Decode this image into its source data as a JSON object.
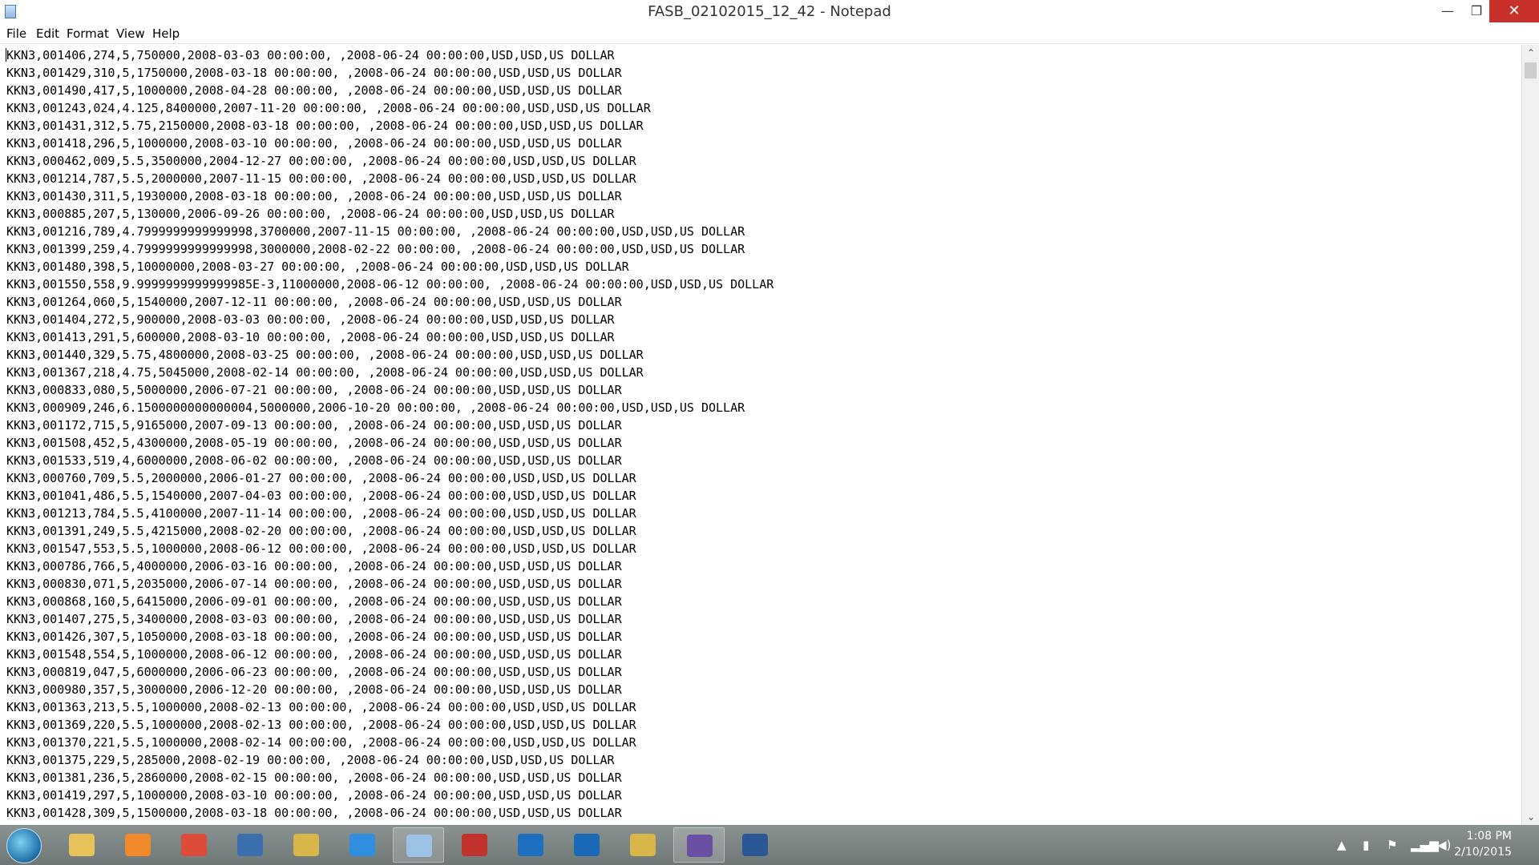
{
  "window": {
    "title": "FASB_02102015_12_42 - Notepad",
    "minimize_glyph": "—",
    "maximize_glyph": "❐",
    "close_glyph": "✕"
  },
  "menu": [
    "File",
    "Edit",
    "Format",
    "View",
    "Help"
  ],
  "lines": [
    "KKN3,001406,274,5,750000,2008-03-03 00:00:00, ,2008-06-24 00:00:00,USD,USD,US DOLLAR",
    "KKN3,001429,310,5,1750000,2008-03-18 00:00:00, ,2008-06-24 00:00:00,USD,USD,US DOLLAR",
    "KKN3,001490,417,5,1000000,2008-04-28 00:00:00, ,2008-06-24 00:00:00,USD,USD,US DOLLAR",
    "KKN3,001243,024,4.125,8400000,2007-11-20 00:00:00, ,2008-06-24 00:00:00,USD,USD,US DOLLAR",
    "KKN3,001431,312,5.75,2150000,2008-03-18 00:00:00, ,2008-06-24 00:00:00,USD,USD,US DOLLAR",
    "KKN3,001418,296,5,1000000,2008-03-10 00:00:00, ,2008-06-24 00:00:00,USD,USD,US DOLLAR",
    "KKN3,000462,009,5.5,3500000,2004-12-27 00:00:00, ,2008-06-24 00:00:00,USD,USD,US DOLLAR",
    "KKN3,001214,787,5.5,2000000,2007-11-15 00:00:00, ,2008-06-24 00:00:00,USD,USD,US DOLLAR",
    "KKN3,001430,311,5,1930000,2008-03-18 00:00:00, ,2008-06-24 00:00:00,USD,USD,US DOLLAR",
    "KKN3,000885,207,5,130000,2006-09-26 00:00:00, ,2008-06-24 00:00:00,USD,USD,US DOLLAR",
    "KKN3,001216,789,4.7999999999999998,3700000,2007-11-15 00:00:00, ,2008-06-24 00:00:00,USD,USD,US DOLLAR",
    "KKN3,001399,259,4.7999999999999998,3000000,2008-02-22 00:00:00, ,2008-06-24 00:00:00,USD,USD,US DOLLAR",
    "KKN3,001480,398,5,10000000,2008-03-27 00:00:00, ,2008-06-24 00:00:00,USD,USD,US DOLLAR",
    "KKN3,001550,558,9.9999999999999985E-3,11000000,2008-06-12 00:00:00, ,2008-06-24 00:00:00,USD,USD,US DOLLAR",
    "KKN3,001264,060,5,1540000,2007-12-11 00:00:00, ,2008-06-24 00:00:00,USD,USD,US DOLLAR",
    "KKN3,001404,272,5,900000,2008-03-03 00:00:00, ,2008-06-24 00:00:00,USD,USD,US DOLLAR",
    "KKN3,001413,291,5,600000,2008-03-10 00:00:00, ,2008-06-24 00:00:00,USD,USD,US DOLLAR",
    "KKN3,001440,329,5.75,4800000,2008-03-25 00:00:00, ,2008-06-24 00:00:00,USD,USD,US DOLLAR",
    "KKN3,001367,218,4.75,5045000,2008-02-14 00:00:00, ,2008-06-24 00:00:00,USD,USD,US DOLLAR",
    "KKN3,000833,080,5,5000000,2006-07-21 00:00:00, ,2008-06-24 00:00:00,USD,USD,US DOLLAR",
    "KKN3,000909,246,6.1500000000000004,5000000,2006-10-20 00:00:00, ,2008-06-24 00:00:00,USD,USD,US DOLLAR",
    "KKN3,001172,715,5,9165000,2007-09-13 00:00:00, ,2008-06-24 00:00:00,USD,USD,US DOLLAR",
    "KKN3,001508,452,5,4300000,2008-05-19 00:00:00, ,2008-06-24 00:00:00,USD,USD,US DOLLAR",
    "KKN3,001533,519,4,6000000,2008-06-02 00:00:00, ,2008-06-24 00:00:00,USD,USD,US DOLLAR",
    "KKN3,000760,709,5.5,2000000,2006-01-27 00:00:00, ,2008-06-24 00:00:00,USD,USD,US DOLLAR",
    "KKN3,001041,486,5.5,1540000,2007-04-03 00:00:00, ,2008-06-24 00:00:00,USD,USD,US DOLLAR",
    "KKN3,001213,784,5.5,4100000,2007-11-14 00:00:00, ,2008-06-24 00:00:00,USD,USD,US DOLLAR",
    "KKN3,001391,249,5.5,4215000,2008-02-20 00:00:00, ,2008-06-24 00:00:00,USD,USD,US DOLLAR",
    "KKN3,001547,553,5.5,1000000,2008-06-12 00:00:00, ,2008-06-24 00:00:00,USD,USD,US DOLLAR",
    "KKN3,000786,766,5,4000000,2006-03-16 00:00:00, ,2008-06-24 00:00:00,USD,USD,US DOLLAR",
    "KKN3,000830,071,5,2035000,2006-07-14 00:00:00, ,2008-06-24 00:00:00,USD,USD,US DOLLAR",
    "KKN3,000868,160,5,6415000,2006-09-01 00:00:00, ,2008-06-24 00:00:00,USD,USD,US DOLLAR",
    "KKN3,001407,275,5,3400000,2008-03-03 00:00:00, ,2008-06-24 00:00:00,USD,USD,US DOLLAR",
    "KKN3,001426,307,5,1050000,2008-03-18 00:00:00, ,2008-06-24 00:00:00,USD,USD,US DOLLAR",
    "KKN3,001548,554,5,1000000,2008-06-12 00:00:00, ,2008-06-24 00:00:00,USD,USD,US DOLLAR",
    "KKN3,000819,047,5,6000000,2006-06-23 00:00:00, ,2008-06-24 00:00:00,USD,USD,US DOLLAR",
    "KKN3,000980,357,5,3000000,2006-12-20 00:00:00, ,2008-06-24 00:00:00,USD,USD,US DOLLAR",
    "KKN3,001363,213,5.5,1000000,2008-02-13 00:00:00, ,2008-06-24 00:00:00,USD,USD,US DOLLAR",
    "KKN3,001369,220,5.5,1000000,2008-02-13 00:00:00, ,2008-06-24 00:00:00,USD,USD,US DOLLAR",
    "KKN3,001370,221,5.5,1000000,2008-02-14 00:00:00, ,2008-06-24 00:00:00,USD,USD,US DOLLAR",
    "KKN3,001375,229,5,285000,2008-02-19 00:00:00, ,2008-06-24 00:00:00,USD,USD,US DOLLAR",
    "KKN3,001381,236,5,2860000,2008-02-15 00:00:00, ,2008-06-24 00:00:00,USD,USD,US DOLLAR",
    "KKN3,001419,297,5,1000000,2008-03-10 00:00:00, ,2008-06-24 00:00:00,USD,USD,US DOLLAR",
    "KKN3,001428,309,5,1500000,2008-03-18 00:00:00, ,2008-06-24 00:00:00,USD,USD,US DOLLAR"
  ],
  "scrollbar": {
    "up_glyph": "⌃",
    "down_glyph": "⌄"
  },
  "taskbar": {
    "apps": [
      {
        "name": "file-explorer",
        "color": "#e8c25a",
        "active": false
      },
      {
        "name": "media-player",
        "color": "#f08a2a",
        "active": false
      },
      {
        "name": "chrome",
        "color": "#dd4b39",
        "active": false
      },
      {
        "name": "remote-desktop",
        "color": "#3a6fb0",
        "active": false
      },
      {
        "name": "tools",
        "color": "#d9b64a",
        "active": false
      },
      {
        "name": "internet-explorer",
        "color": "#2f8ee0",
        "active": false
      },
      {
        "name": "notepad",
        "color": "#9cc3e6",
        "active": true
      },
      {
        "name": "toolbox",
        "color": "#c2322d",
        "active": false
      },
      {
        "name": "lync",
        "color": "#1f6fc0",
        "active": false
      },
      {
        "name": "outlook",
        "color": "#1a6ab8",
        "active": false
      },
      {
        "name": "tools-2",
        "color": "#d9b64a",
        "active": false
      },
      {
        "name": "visual-studio",
        "color": "#6a4fa3",
        "active": true
      },
      {
        "name": "word",
        "color": "#2b5797",
        "active": false
      }
    ],
    "tray": {
      "chevron_glyph": "▲",
      "time": "1:08 PM",
      "date": "2/10/2015"
    }
  }
}
